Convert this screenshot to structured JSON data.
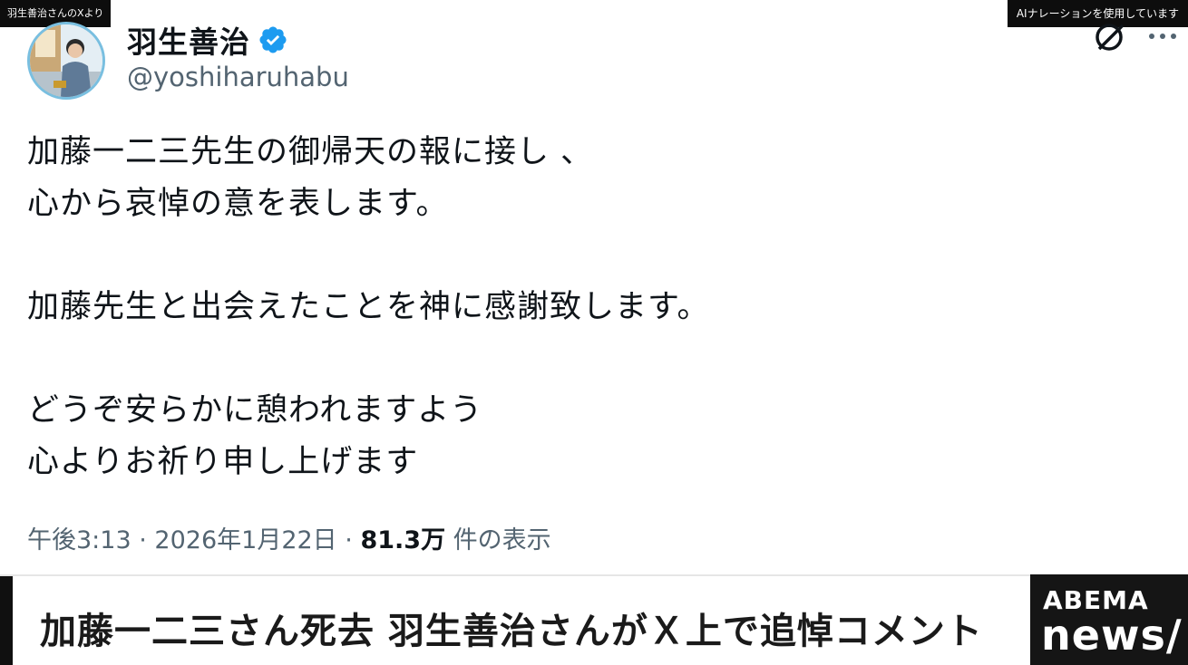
{
  "overlay": {
    "source_label": "羽生善治さんのXより",
    "ai_notice": "AIナレーションを使用しています"
  },
  "tweet": {
    "display_name": "羽生善治",
    "handle": "@yoshiharuhabu",
    "verified": true,
    "lines": [
      "加藤一二三先生の御帰天の報に接し 、",
      "心から哀悼の意を表します。",
      "",
      "加藤先生と出会えたことを神に感謝致します。",
      "",
      "どうぞ安らかに憩われますよう",
      "心よりお祈り申し上げます"
    ],
    "time": "午後3:13",
    "separator": "·",
    "date": "2026年1月22日",
    "views_count": "81.3万",
    "views_label": "件の表示"
  },
  "caption": {
    "headline": "加藤一二三さん死去 羽生善治さんがＸ上で追悼コメント"
  },
  "logo": {
    "top": "ABEMA",
    "bottom": "news/"
  },
  "icons": {
    "verified": "verified-badge-icon",
    "grok": "grok-icon",
    "more": "more-options-icon"
  },
  "colors": {
    "verified_blue": "#1d9bf0",
    "secondary_text": "#536471",
    "primary_text": "#0f1419",
    "logo_bg": "#151515"
  }
}
